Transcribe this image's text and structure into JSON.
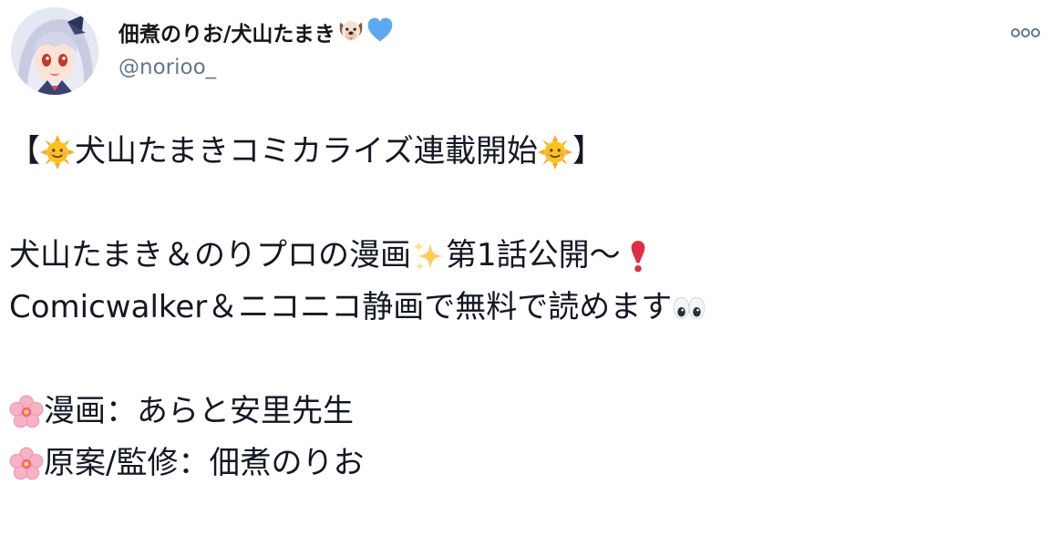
{
  "author": {
    "display_name": "佃煮のりお/犬山たまき",
    "handle": "@norioo_",
    "name_emojis": [
      "dog-face-icon",
      "blue-heart-icon"
    ]
  },
  "more_button": {
    "icon": "more-options-icon",
    "label": "ooo"
  },
  "tweet": {
    "line1": "犬山たまきコミカライズ連載開始",
    "line1_open": "【",
    "line1_close": "】",
    "line3_a": "犬山たまき＆のりプロの漫画",
    "line3_b": "第1話公開〜",
    "line4": "Comicwalker＆ニコニコ静画で無料で読めます",
    "line6": "漫画：あらと安里先生",
    "line7": "原案/監修：佃煮のりお"
  },
  "colors": {
    "text": "#141823",
    "secondary": "#657786",
    "accent_heart": "#5da8ee"
  }
}
